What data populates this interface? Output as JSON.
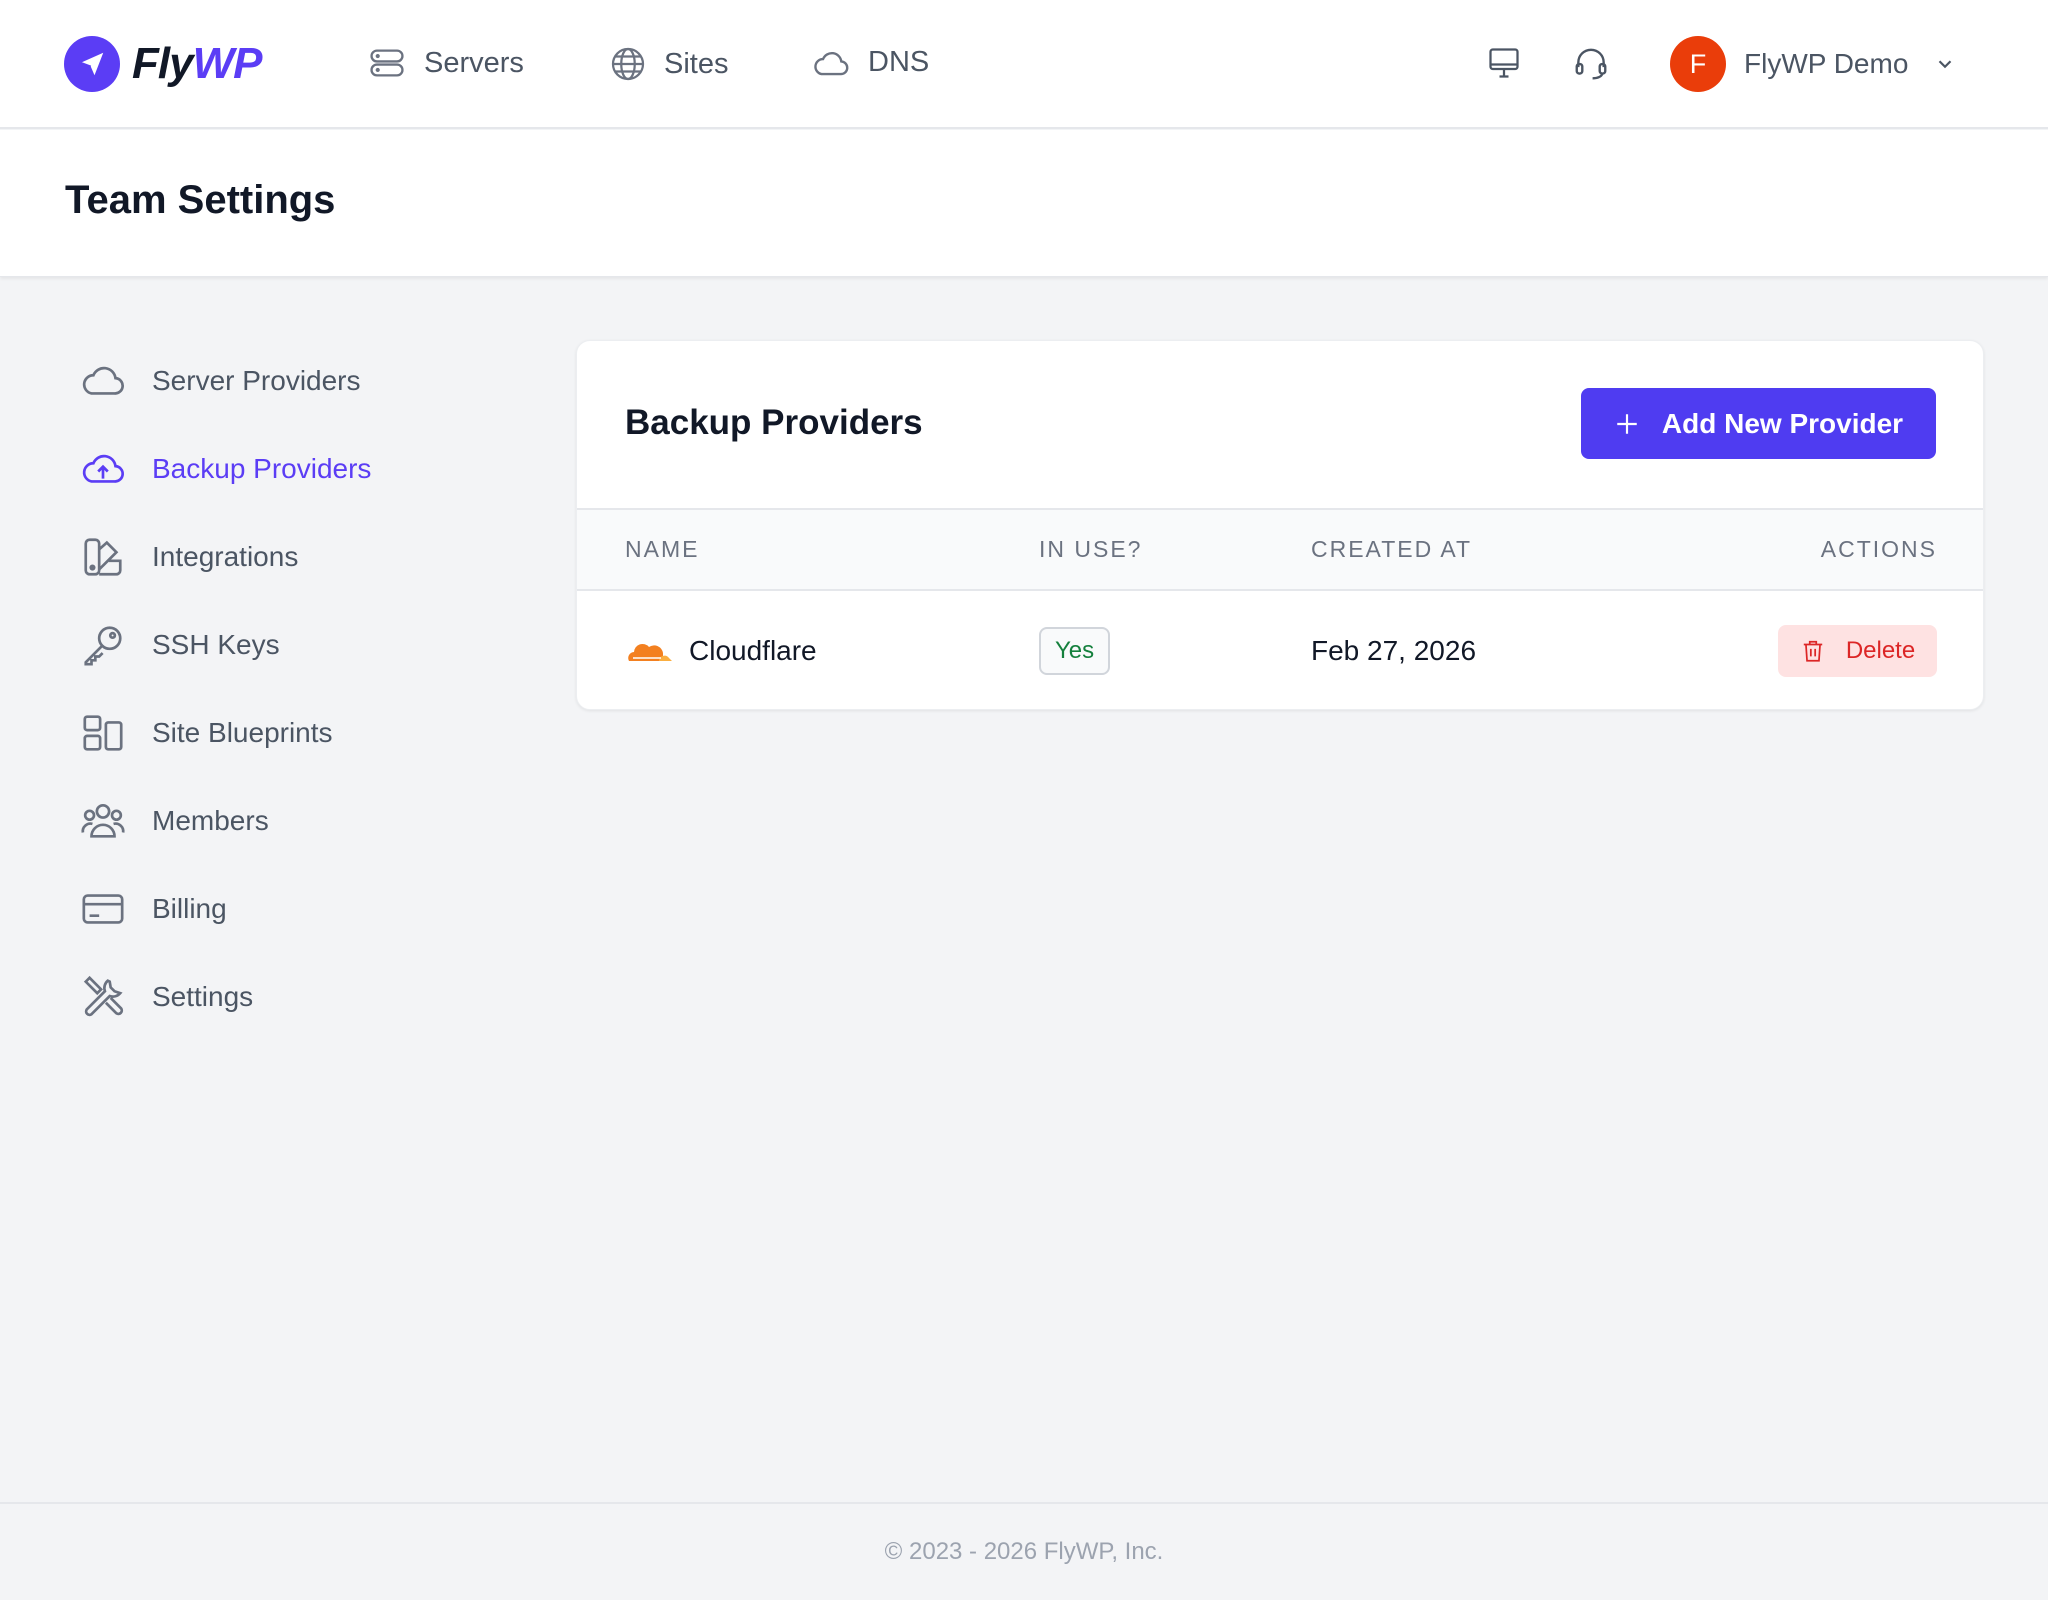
{
  "app": {
    "brand_prefix": "Fly",
    "brand_suffix": "WP",
    "brand_color": "#5b3df5"
  },
  "nav": {
    "items": [
      {
        "label": "Servers",
        "icon": "server-icon"
      },
      {
        "label": "Sites",
        "icon": "globe-icon"
      },
      {
        "label": "DNS",
        "icon": "cloud-icon"
      }
    ],
    "right_icons": [
      "monitor-icon",
      "headset-icon"
    ]
  },
  "user": {
    "initial": "F",
    "name": "FlyWP Demo",
    "avatar_color": "#ea3d0a"
  },
  "page": {
    "title": "Team Settings"
  },
  "sidebar": {
    "items": [
      {
        "label": "Server Providers",
        "icon": "cloud-icon",
        "active": false
      },
      {
        "label": "Backup Providers",
        "icon": "cloud-upload-icon",
        "active": true
      },
      {
        "label": "Integrations",
        "icon": "swatch-icon",
        "active": false
      },
      {
        "label": "SSH Keys",
        "icon": "key-icon",
        "active": false
      },
      {
        "label": "Site Blueprints",
        "icon": "layout-icon",
        "active": false
      },
      {
        "label": "Members",
        "icon": "users-icon",
        "active": false
      },
      {
        "label": "Billing",
        "icon": "credit-card-icon",
        "active": false
      },
      {
        "label": "Settings",
        "icon": "wrench-screwdriver-icon",
        "active": false
      }
    ]
  },
  "card": {
    "title": "Backup Providers",
    "add_button_label": "Add New Provider",
    "columns": [
      "NAME",
      "IN USE?",
      "CREATED AT",
      "ACTIONS"
    ],
    "rows": [
      {
        "name": "Cloudflare",
        "icon": "cloudflare-icon",
        "in_use": "Yes",
        "created_at": "Feb 27, 2026",
        "action_label": "Delete"
      }
    ]
  },
  "footer": {
    "text": "© 2023 - 2026 FlyWP, Inc."
  }
}
